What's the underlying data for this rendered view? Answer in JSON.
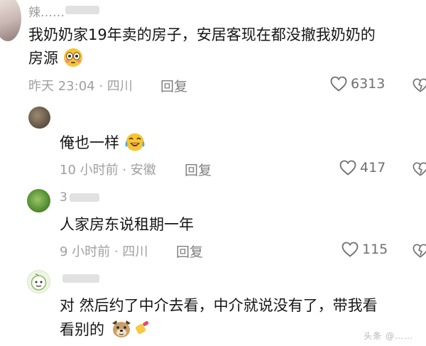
{
  "comments": [
    {
      "username": "辣……",
      "line1": "我奶奶家19年卖的房子，安居客现在都没撤我奶奶的",
      "line2": "房源",
      "emoji": "flushed-face-emoji",
      "time_location": "昨天 23:04 · 四川",
      "reply_label": "回复",
      "likes": "6313"
    },
    {
      "username": "",
      "line1": "俺也一样",
      "emoji": "laughing-crying-emoji",
      "time_location": "10 小时前 · 安徽",
      "reply_label": "回复",
      "likes": "417"
    },
    {
      "username": "3",
      "line1": "人家房东说租期一年",
      "time_location": "9 小时前 · 四川",
      "reply_label": "回复",
      "likes": "115"
    },
    {
      "username": "",
      "line1": "对 然后约了中介去看，中介就说没有了，带我看",
      "line2": "看别的",
      "emoji": "dog-and-pointing-hand-emoji"
    }
  ],
  "watermark": "头条 @……",
  "colors": {
    "heart": "#6f6f6f",
    "meta": "#9f9f9f"
  }
}
